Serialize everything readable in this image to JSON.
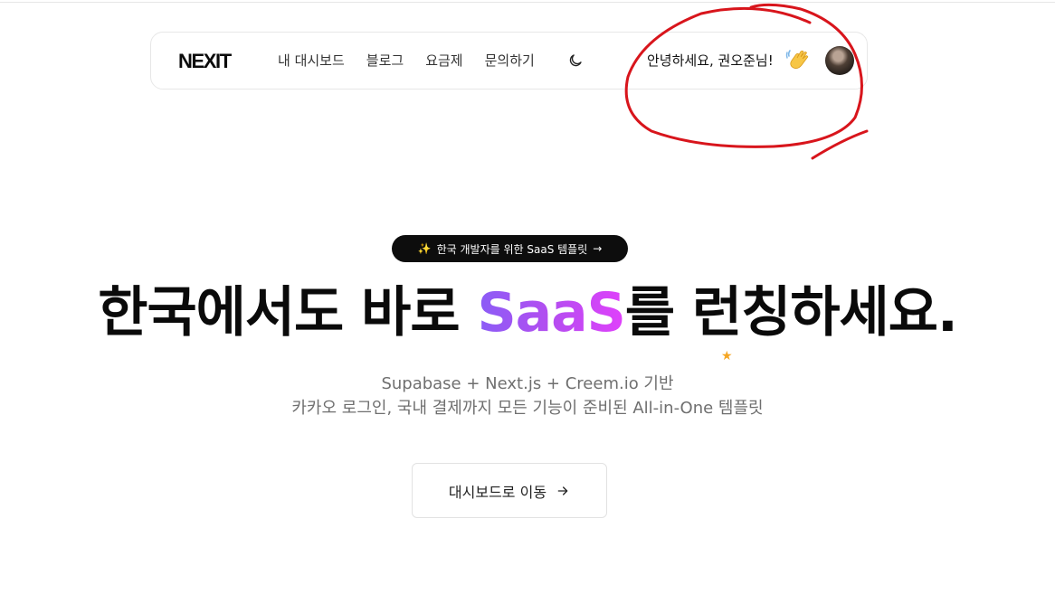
{
  "nav": {
    "logo": "NEXIT",
    "menu": [
      "내 대시보드",
      "블로그",
      "요금제",
      "문의하기"
    ],
    "theme_icon": "moon-icon",
    "greeting": "안녕하세요, 권오준님!",
    "wave_icon": "waving-hand-icon",
    "avatar_icon": "user-avatar"
  },
  "hero": {
    "badge": {
      "spark": "✨",
      "text": "한국 개발자를 위한 SaaS 템플릿",
      "arrow": "→"
    },
    "headline": {
      "part1": "한국에서도 바로 ",
      "saas": "SaaS",
      "part2": "를 ",
      "launch": "런칭",
      "part3": "하세요."
    },
    "subtitle_line1": "Supabase + Next.js + Creem.io 기반",
    "subtitle_line2": "카카오 로그인, 국내 결제까지 모든 기능이 준비된 All-in-One 템플릿",
    "cta_label": "대시보드로 이동"
  },
  "colors": {
    "accent_gradient_start": "#8a5cf6",
    "accent_gradient_end": "#e040fb",
    "annotation": "#d8151c"
  }
}
